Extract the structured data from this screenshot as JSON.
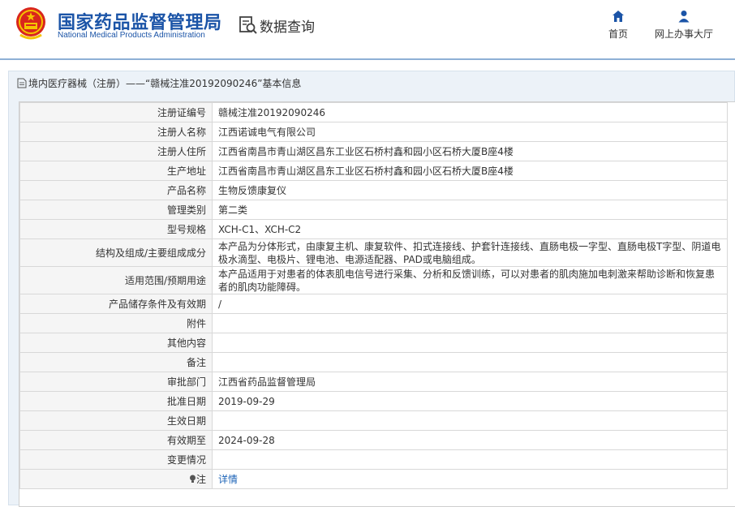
{
  "header": {
    "org_name_cn": "国家药品监督管理局",
    "org_name_en": "National Medical Products Administration",
    "query_label": "数据查询",
    "nav": [
      {
        "label": "首页",
        "icon": "home-icon"
      },
      {
        "label": "网上办事大厅",
        "icon": "user-icon"
      }
    ]
  },
  "breadcrumb": {
    "icon": "document-icon",
    "text": "境内医疗器械（注册）——“赣械注准20192090246”基本信息"
  },
  "colors": {
    "brand": "#1b54a7",
    "link": "#1c63b7",
    "label_bg": "#f5f5f5",
    "panel_bg": "#ecf2f8"
  },
  "rows": [
    {
      "label": "注册证编号",
      "value": "赣械注准20192090246"
    },
    {
      "label": "注册人名称",
      "value": "江西诺诚电气有限公司"
    },
    {
      "label": "注册人住所",
      "value": "江西省南昌市青山湖区昌东工业区石桥村鑫和园小区石桥大厦B座4楼"
    },
    {
      "label": "生产地址",
      "value": "江西省南昌市青山湖区昌东工业区石桥村鑫和园小区石桥大厦B座4楼"
    },
    {
      "label": "产品名称",
      "value": "生物反馈康复仪"
    },
    {
      "label": "管理类别",
      "value": "第二类"
    },
    {
      "label": "型号规格",
      "value": "XCH-C1、XCH-C2"
    },
    {
      "label": "结构及组成/主要组成成分",
      "value": "本产品为分体形式，由康复主机、康复软件、扣式连接线、护套针连接线、直肠电极一字型、直肠电极T字型、阴道电极水滴型、电极片、锂电池、电源适配器、PAD或电脑组成。"
    },
    {
      "label": "适用范围/预期用途",
      "value": "本产品适用于对患者的体表肌电信号进行采集、分析和反馈训练，可以对患者的肌肉施加电刺激来帮助诊断和恢复患者的肌肉功能障碍。"
    },
    {
      "label": "产品储存条件及有效期",
      "value": "/"
    },
    {
      "label": "附件",
      "value": ""
    },
    {
      "label": "其他内容",
      "value": ""
    },
    {
      "label": "备注",
      "value": ""
    },
    {
      "label": "审批部门",
      "value": "江西省药品监督管理局"
    },
    {
      "label": "批准日期",
      "value": "2019-09-29"
    },
    {
      "label": "生效日期",
      "value": ""
    },
    {
      "label": "有效期至",
      "value": "2024-09-28"
    },
    {
      "label": "变更情况",
      "value": ""
    }
  ],
  "note_row": {
    "icon": "lightbulb-icon",
    "label": "注",
    "link": "详情"
  }
}
